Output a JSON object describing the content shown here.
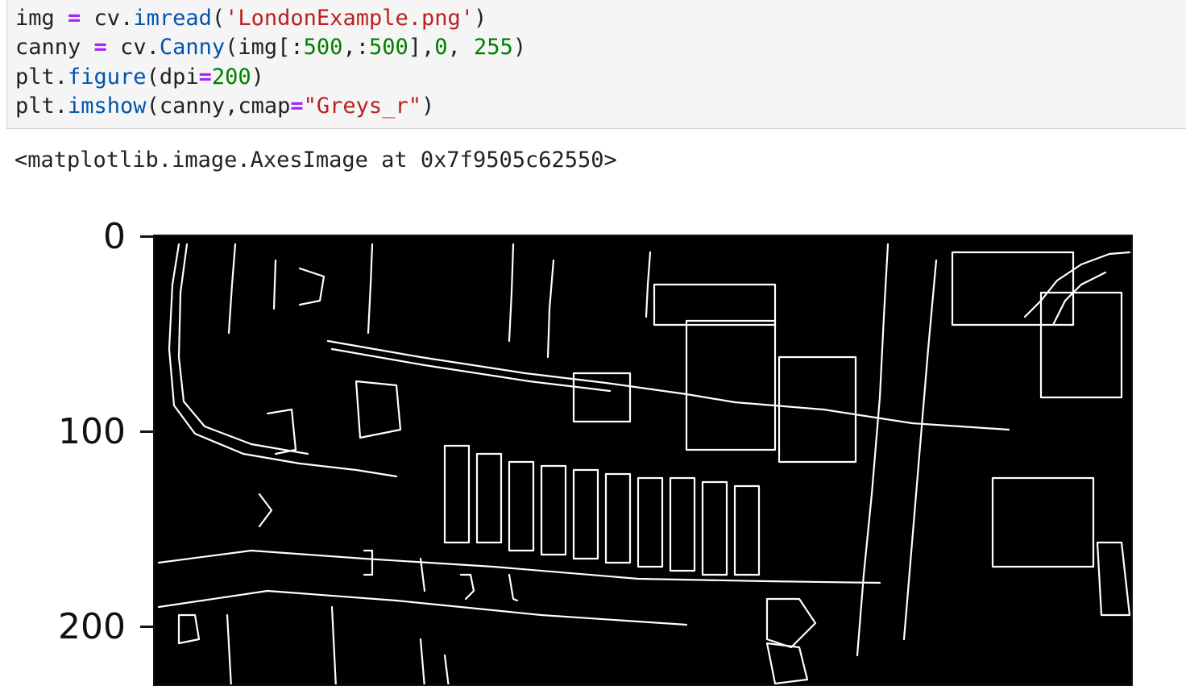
{
  "code_cell": {
    "lines": [
      [
        {
          "t": "img ",
          "k": "plain"
        },
        {
          "t": "=",
          "k": "op"
        },
        {
          "t": " cv.",
          "k": "plain"
        },
        {
          "t": "imread",
          "k": "fn"
        },
        {
          "t": "(",
          "k": "plain"
        },
        {
          "t": "'LondonExample.png'",
          "k": "str"
        },
        {
          "t": ")",
          "k": "plain"
        }
      ],
      [
        {
          "t": "canny ",
          "k": "plain"
        },
        {
          "t": "=",
          "k": "op"
        },
        {
          "t": " cv.",
          "k": "plain"
        },
        {
          "t": "Canny",
          "k": "fn"
        },
        {
          "t": "(img[:",
          "k": "plain"
        },
        {
          "t": "500",
          "k": "num"
        },
        {
          "t": ",:",
          "k": "plain"
        },
        {
          "t": "500",
          "k": "num"
        },
        {
          "t": "],",
          "k": "plain"
        },
        {
          "t": "0",
          "k": "num"
        },
        {
          "t": ", ",
          "k": "plain"
        },
        {
          "t": "255",
          "k": "num"
        },
        {
          "t": ")",
          "k": "plain"
        }
      ],
      [
        {
          "t": "plt.",
          "k": "plain"
        },
        {
          "t": "figure",
          "k": "fn"
        },
        {
          "t": "(dpi",
          "k": "plain"
        },
        {
          "t": "=",
          "k": "op"
        },
        {
          "t": "200",
          "k": "num"
        },
        {
          "t": ")",
          "k": "plain"
        }
      ],
      [
        {
          "t": "plt.",
          "k": "plain"
        },
        {
          "t": "imshow",
          "k": "fn"
        },
        {
          "t": "(canny,cmap",
          "k": "plain"
        },
        {
          "t": "=",
          "k": "op"
        },
        {
          "t": "\"Greys_r\"",
          "k": "str"
        },
        {
          "t": ")",
          "k": "plain"
        }
      ]
    ]
  },
  "output": {
    "repr_text": "<matplotlib.image.AxesImage at 0x7f9505c62550>"
  },
  "plot": {
    "y_tick_labels": [
      "0",
      "100",
      "200"
    ],
    "image_description_colors": {
      "background": "#000000",
      "edges": "#ffffff"
    }
  }
}
